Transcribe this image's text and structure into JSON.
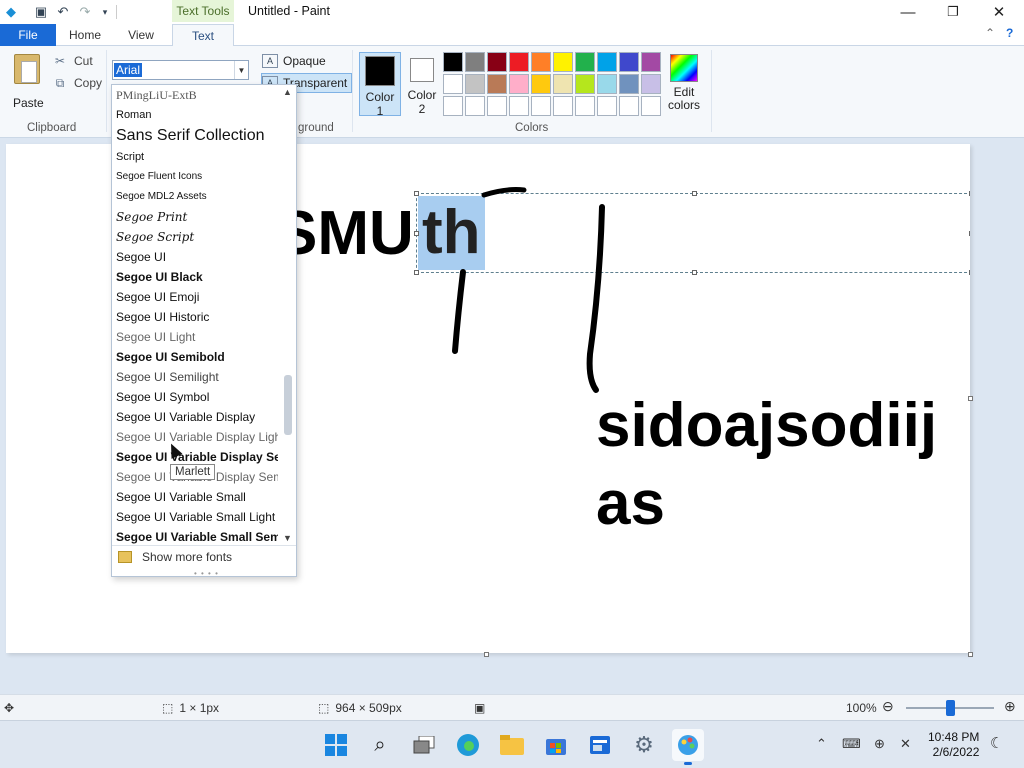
{
  "titlebar": {
    "context_tab": "Text Tools",
    "title": "Untitled - Paint"
  },
  "ribbon_tabs": {
    "file": "File",
    "home": "Home",
    "view": "View",
    "text": "Text"
  },
  "clipboard": {
    "paste": "Paste",
    "cut": "Cut",
    "copy": "Copy",
    "group": "Clipboard"
  },
  "font": {
    "value": "Arial"
  },
  "background": {
    "opaque": "Opaque",
    "transparent": "Transparent",
    "group": "ground"
  },
  "colors": {
    "color1": "Color 1",
    "color1_line1": "Color",
    "color1_line2": "1",
    "color2_line1": "Color",
    "color2_line2": "2",
    "group": "Colors",
    "edit_line1": "Edit",
    "edit_line2": "colors",
    "color1_value": "#000000",
    "color2_value": "#ffffff",
    "palette": [
      "#000000",
      "#7f7f7f",
      "#880015",
      "#ed1c24",
      "#ff7f27",
      "#fff200",
      "#22b14c",
      "#00a2e8",
      "#3f48cc",
      "#a349a4",
      "#ffffff",
      "#c3c3c3",
      "#b97a57",
      "#ffaec9",
      "#ffc90e",
      "#efe4b0",
      "#b5e61d",
      "#99d9ea",
      "#7092be",
      "#c8bfe7",
      "#ffffff",
      "#ffffff",
      "#ffffff",
      "#ffffff",
      "#ffffff",
      "#ffffff",
      "#ffffff",
      "#ffffff",
      "#ffffff",
      "#ffffff"
    ]
  },
  "canvas": {
    "text1": "SMU",
    "text1_selected": "th",
    "text2_line1": "sidoajsodiij",
    "text2_line2": "as"
  },
  "font_dropdown": {
    "items": [
      "PMingLiU-ExtB",
      "Roman",
      "Sans Serif Collection",
      "Script",
      "Segoe Fluent Icons",
      "Segoe MDL2 Assets",
      "Segoe Print",
      "Segoe Script",
      "Segoe UI",
      "Segoe UI Black",
      "Segoe UI Emoji",
      "Segoe UI Historic",
      "Segoe UI Light",
      "Segoe UI Semibold",
      "Segoe UI Semilight",
      "Segoe UI Symbol",
      "Segoe UI Variable Display",
      "Segoe UI Variable Display Light",
      "Segoe UI Variable Display Semibold",
      "Segoe UI Variable Display Semilight",
      "Segoe UI Variable Small",
      "Segoe UI Variable Small Light",
      "Segoe UI Variable Small Semibold"
    ],
    "show_more": "Show more fonts",
    "tooltip": "Marlett"
  },
  "statusbar": {
    "selection_size": "1 × 1px",
    "canvas_size": "964 × 509px",
    "zoom": "100%",
    "zoom_level": 0.5
  },
  "taskbar": {
    "time": "10:48 PM",
    "date": "2/6/2022"
  }
}
